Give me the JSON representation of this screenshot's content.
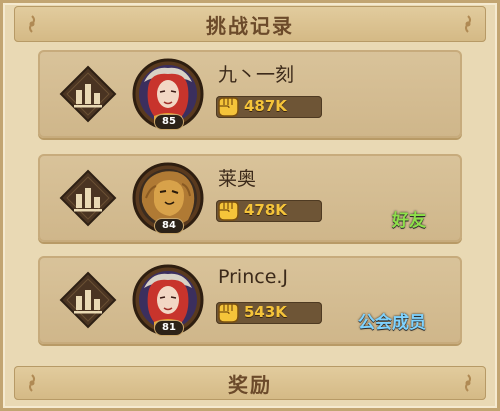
{
  "header": {
    "title": "挑战记录"
  },
  "records": [
    {
      "name": "九丶一刻",
      "level": "85",
      "power": "487K",
      "tag": "",
      "avatar": "red-haired-winged-hero-portrait"
    },
    {
      "name": "莱奥",
      "level": "84",
      "power": "478K",
      "tag": "好友",
      "avatar": "lion-hero-portrait"
    },
    {
      "name": "Prince.J",
      "level": "81",
      "power": "543K",
      "tag": "公会成员",
      "avatar": "red-haired-winged-hero-portrait"
    }
  ],
  "footer": {
    "rewards_label": "奖励"
  },
  "colors": {
    "power_text": "#f5c43a",
    "friend_tag": "#8ee04a",
    "guild_tag": "#7fd3ff",
    "panel": "#e9d9b4"
  },
  "icons": [
    "bar-chart-icon",
    "fist-icon",
    "ornament-icon"
  ]
}
